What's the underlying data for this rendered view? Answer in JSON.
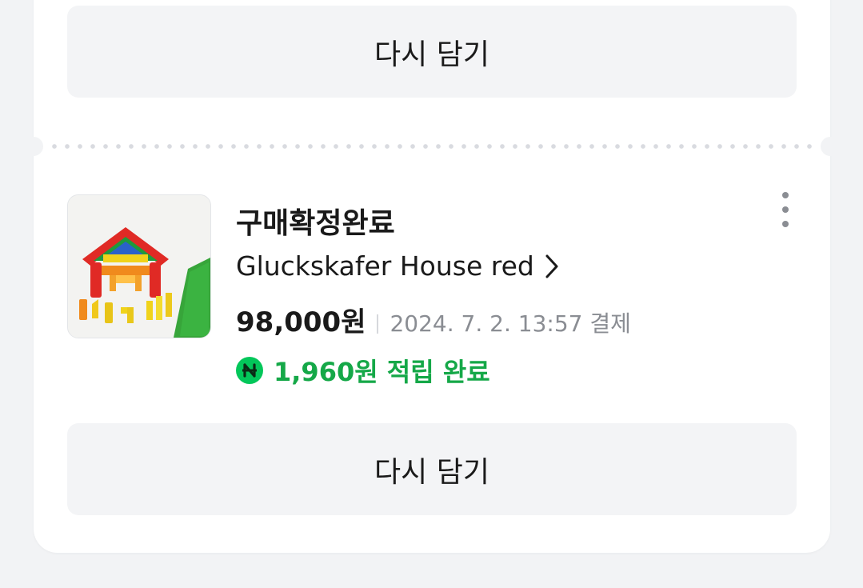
{
  "buttons": {
    "top_label": "다시 담기",
    "bottom_label": "다시 담기"
  },
  "order": {
    "status": "구매확정완료",
    "product_name": "Gluckskafer House red",
    "price": "98,000원",
    "payment_date": "2024. 7. 2. 13:57 결제",
    "reward": "1,960원 적립 완료"
  },
  "icons": {
    "more": "more-vertical-icon",
    "chevron": "chevron-right-icon",
    "points": "naver-points-icon"
  },
  "colors": {
    "reward_green": "#15a848",
    "points_badge": "#03c75a",
    "button_bg": "#f3f4f6"
  }
}
